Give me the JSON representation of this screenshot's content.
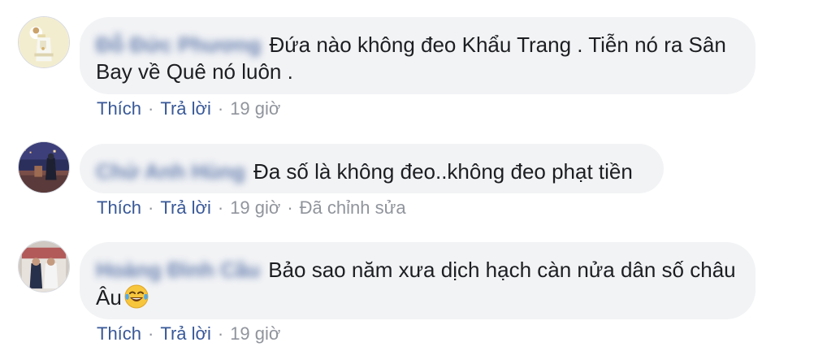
{
  "comments": [
    {
      "author": "Đỗ Đức Phương",
      "text": "Đứa nào không đeo Khẩu Trang . Tiễn nó ra Sân Bay về Quê nó luôn .",
      "like_label": "Thích",
      "reply_label": "Trả lời",
      "time": "19 giờ",
      "edited": ""
    },
    {
      "author": "Chử Anh Hùng",
      "text": "Đa số là không đeo..không đeo phạt tiền",
      "like_label": "Thích",
      "reply_label": "Trả lời",
      "time": "19 giờ",
      "edited": "Đã chỉnh sửa"
    },
    {
      "author": "Hoàng Đình Cầu",
      "text": "Bảo sao năm xưa dịch hạch càn nửa dân số châu Âu",
      "emoji": "tears-of-joy-emoji",
      "like_label": "Thích",
      "reply_label": "Trả lời",
      "time": "19 giờ",
      "edited": ""
    }
  ],
  "separator": "·",
  "colors": {
    "link": "#385898",
    "meta": "#90949c",
    "bubble": "#f2f3f5",
    "text": "#1c1e21"
  }
}
